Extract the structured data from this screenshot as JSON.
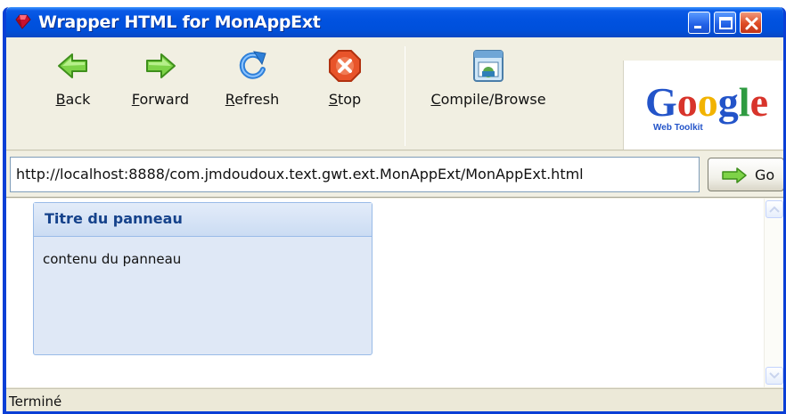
{
  "window": {
    "title": "Wrapper HTML for MonAppExt"
  },
  "toolbar": {
    "back": {
      "prefix": "",
      "accel": "B",
      "rest": "ack"
    },
    "forward": {
      "prefix": "",
      "accel": "F",
      "rest": "orward"
    },
    "refresh": {
      "prefix": "",
      "accel": "R",
      "rest": "efresh"
    },
    "stop": {
      "prefix": "",
      "accel": "S",
      "rest": "top"
    },
    "compile": {
      "prefix": "",
      "accel": "C",
      "rest": "ompile/Browse"
    },
    "logo": {
      "main": "Google",
      "sub": "Web Toolkit"
    }
  },
  "address": {
    "url": "http://localhost:8888/com.jmdoudoux.text.gwt.ext.MonAppExt/MonAppExt.html",
    "go_label": "Go"
  },
  "panel": {
    "title": "Titre du panneau",
    "body": "contenu du panneau"
  },
  "status": {
    "text": "Terminé"
  },
  "colors": {
    "titlebar": "#0050db",
    "panel_header_text": "#15428b",
    "panel_border": "#99bbe8",
    "arrow_green": "#5cbf2a",
    "refresh_blue": "#2e7fd8",
    "stop_red": "#e24a1c"
  },
  "icons": {
    "app": "gwt-red-gem-icon",
    "back": "green-arrow-left-icon",
    "forward": "green-arrow-right-icon",
    "refresh": "blue-refresh-icon",
    "stop": "red-stop-icon",
    "compile": "compile-browse-icon"
  }
}
